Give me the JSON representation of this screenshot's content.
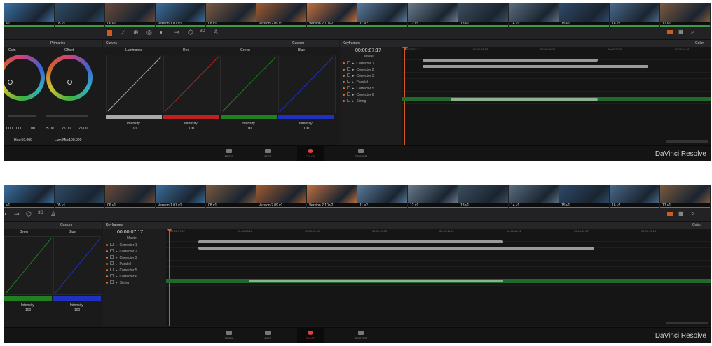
{
  "thumbs": [
    {
      "label": "v1",
      "color": "#3a6fa0"
    },
    {
      "label": "05 v1",
      "color": "#2e4e6a"
    },
    {
      "label": "06 v1",
      "color": "#6a4a3a"
    },
    {
      "label": "Version 1 07 v1",
      "color": "#3c6e9c"
    },
    {
      "label": "08 v1",
      "color": "#7a5a40"
    },
    {
      "label": "Version 2 09 v1",
      "color": "#a05a30"
    },
    {
      "label": "Version 2 10 v2",
      "color": "#c07040"
    },
    {
      "label": "11 v2",
      "color": "#5a7a9a"
    },
    {
      "label": "12 v1",
      "color": "#6a7a8a"
    },
    {
      "label": "13 v1",
      "color": "#3c4e5e"
    },
    {
      "label": "14 v1",
      "color": "#5a6e80"
    },
    {
      "label": "15 v1",
      "color": "#2e4a6a"
    },
    {
      "label": "16 v2",
      "color": "#4a6a8a"
    },
    {
      "label": "17 v1",
      "color": "#7a5a40"
    }
  ],
  "panel1": {
    "sections": {
      "primaries": "Primaries",
      "curves": "Curves",
      "custom": "Custom",
      "keyframes": "Keyframes",
      "color": "Color"
    },
    "wheels": [
      {
        "label": "Gain",
        "color": "#c04080"
      },
      {
        "label": "Offset",
        "color": "#4080c0"
      }
    ],
    "wheel_values": [
      "1.00",
      "1.00",
      "1.00",
      "25.00",
      "25.00",
      "25.00"
    ],
    "curves": [
      {
        "label": "Luminance",
        "color": "#aaaaaa"
      },
      {
        "label": "Red",
        "color": "#c02020"
      },
      {
        "label": "Green",
        "color": "#208020"
      },
      {
        "label": "Blue",
        "color": "#2030c0"
      }
    ],
    "intensity_label": "Intensity",
    "intensity_value": "100",
    "hue_text": "Hue:50.000",
    "lum_text": "Lum Mix:100.000",
    "timecode": "00:00:07:17",
    "ruler": [
      "00:00:07:17",
      "00:00:08:13",
      "00:00:09:09",
      "00:00:10:05",
      "00:00:11:01"
    ],
    "tracks": [
      "Master",
      "Corrector 1",
      "Corrector 2",
      "Corrector 3",
      "Parallel",
      "Corrector 5",
      "Corrector 6",
      "Sizing"
    ]
  },
  "panel2": {
    "sections": {
      "custom": "Custom",
      "keyframes": "Keyframes",
      "color": "Color"
    },
    "curves": [
      {
        "label": "Green",
        "color": "#208020"
      },
      {
        "label": "Blue",
        "color": "#2030c0"
      }
    ],
    "intensity_label": "Intensity",
    "intensity_value": "100",
    "timecode": "00:00:07:17",
    "ruler": [
      "00:00:07:17",
      "00:00:08:13",
      "00:00:09:09",
      "00:00:10:05",
      "00:00:11:01",
      "00:00:11:21",
      "00:00:12:17",
      "00:00:13:13"
    ],
    "tracks": [
      "Master",
      "Corrector 1",
      "Corrector 2",
      "Corrector 3",
      "Parallel",
      "Corrector 5",
      "Corrector 6",
      "Sizing"
    ]
  },
  "pages": [
    "MEDIA",
    "EDIT",
    "COLOR",
    "DELIVER"
  ],
  "brand": "DaVinci Resolve"
}
